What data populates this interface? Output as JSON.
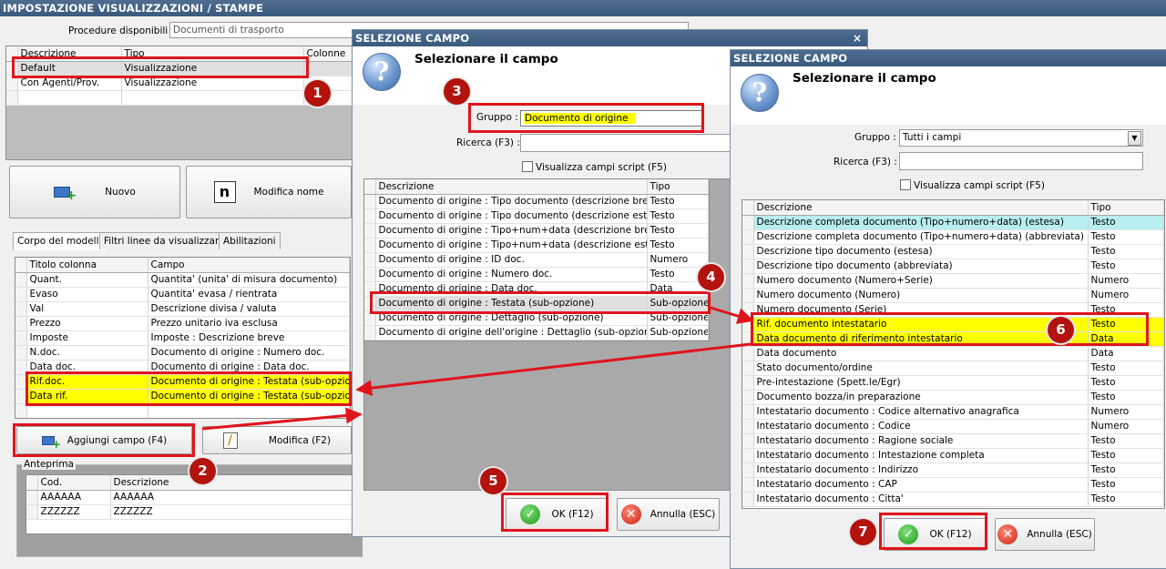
{
  "main": {
    "title": "IMPOSTAZIONE VISUALIZZAZIONI / STAMPE",
    "procedure_label": "Procedure disponibili :",
    "procedure_value": "Documenti di trasporto",
    "views_headers": [
      "Descrizione",
      "Tipo",
      "Colonne"
    ],
    "views_rows": [
      [
        "Default",
        "Visualizzazione",
        ""
      ],
      [
        "Con Agenti/Prov.",
        "Visualizzazione",
        ""
      ]
    ],
    "btn_nuovo": "Nuovo",
    "btn_modifica_nome": "Modifica nome",
    "tabs": [
      "Corpo del modello",
      "Filtri linee da visualizzare",
      "Abilitazioni"
    ],
    "columns_headers": [
      "Titolo colonna",
      "Campo"
    ],
    "columns_rows": [
      [
        "Quant.",
        "Quantita' (unita' di misura documento)"
      ],
      [
        "Evaso",
        "Quantita' evasa / rientrata"
      ],
      [
        "Val",
        "Descrizione divisa / valuta"
      ],
      [
        "Prezzo",
        "Prezzo unitario iva esclusa"
      ],
      [
        "Imposte",
        "Imposte : Descrizione breve"
      ],
      [
        "N.doc.",
        "Documento di origine : Numero doc."
      ],
      [
        "Data doc.",
        "Documento di origine : Data doc."
      ],
      [
        "Rif.doc.",
        "Documento di origine : Testata (sub-opzione)"
      ],
      [
        "Data rif.",
        "Documento di origine : Testata (sub-opzione)"
      ]
    ],
    "btn_aggiungi": "Aggiungi campo (F4)",
    "btn_modifica": "Modifica (F2)",
    "anteprima_label": "Anteprima",
    "preview_headers": [
      "Cod.",
      "Descrizione"
    ],
    "preview_rows": [
      [
        "AAAAAA",
        "AAAAAA"
      ],
      [
        "ZZZZZZ",
        "ZZZZZZ"
      ]
    ]
  },
  "dialog1": {
    "title": "SELEZIONE CAMPO",
    "close": "×",
    "heading": "Selezionare il campo",
    "gruppo_label": "Gruppo :",
    "gruppo_value": "Documento di origine",
    "ricerca_label": "Ricerca (F3) :",
    "ricerca_value": "",
    "checkbox_label": "Visualizza campi script (F5)",
    "headers": [
      "Descrizione",
      "Tipo"
    ],
    "rows": [
      [
        "Documento di origine : Tipo documento (descrizione breve)",
        "Testo"
      ],
      [
        "Documento di origine : Tipo documento (descrizione estesa)",
        "Testo"
      ],
      [
        "Documento di origine : Tipo+num+data (descrizione breve)",
        "Testo"
      ],
      [
        "Documento di origine : Tipo+num+data (descrizione estesa)",
        "Testo"
      ],
      [
        "Documento di origine : ID doc.",
        "Numero"
      ],
      [
        "Documento di origine : Numero doc.",
        "Testo"
      ],
      [
        "Documento di origine : Data doc.",
        "Data"
      ],
      [
        "Documento di origine : Testata (sub-opzione)",
        "Sub-opzione"
      ],
      [
        "Documento di origine : Dettaglio (sub-opzione)",
        "Sub-opzione"
      ],
      [
        "Documento di origine dell'origine : Dettaglio (sub-opzione)",
        "Sub-opzione"
      ]
    ],
    "ok": "OK (F12)",
    "cancel": "Annulla (ESC)"
  },
  "dialog2": {
    "title": "SELEZIONE CAMPO",
    "heading": "Selezionare il campo",
    "gruppo_label": "Gruppo :",
    "gruppo_value": "Tutti i campi",
    "ricerca_label": "Ricerca (F3) :",
    "ricerca_value": "",
    "checkbox_label": "Visualizza campi script (F5)",
    "headers": [
      "Descrizione",
      "Tipo"
    ],
    "rows": [
      [
        "Descrizione completa documento (Tipo+numero+data) (estesa)",
        "Testo"
      ],
      [
        "Descrizione completa documento (Tipo+numero+data) (abbreviata)",
        "Testo"
      ],
      [
        "Descrizione tipo documento (estesa)",
        "Testo"
      ],
      [
        "Descrizione tipo documento (abbreviata)",
        "Testo"
      ],
      [
        "Numero documento (Numero+Serie)",
        "Numero"
      ],
      [
        "Numero documento (Numero)",
        "Numero"
      ],
      [
        "Numero documento (Serie)",
        "Testo"
      ],
      [
        "Rif. documento intestatario",
        "Testo"
      ],
      [
        "Data documento di riferimento intestatario",
        "Data"
      ],
      [
        "Data documento",
        "Data"
      ],
      [
        "Stato documento/ordine",
        "Testo"
      ],
      [
        "Pre-intestazione (Spett.le/Egr)",
        "Testo"
      ],
      [
        "Documento bozza/in preparazione",
        "Testo"
      ],
      [
        "Intestatario documento : Codice alternativo anagrafica",
        "Numero"
      ],
      [
        "Intestatario documento : Codice",
        "Numero"
      ],
      [
        "Intestatario documento : Ragione sociale",
        "Testo"
      ],
      [
        "Intestatario documento : Intestazione completa",
        "Testo"
      ],
      [
        "Intestatario documento : Indirizzo",
        "Testo"
      ],
      [
        "Intestatario documento : CAP",
        "Testo"
      ],
      [
        "Intestatario documento : Citta'",
        "Testo"
      ]
    ],
    "ok": "OK (F12)",
    "cancel": "Annulla (ESC)"
  },
  "badges": [
    "1",
    "2",
    "3",
    "4",
    "5",
    "6",
    "7"
  ],
  "icons": {
    "help": "question-icon",
    "ok": "check-icon",
    "cancel": "x-icon",
    "add": "add-field-icon",
    "edit": "pencil-icon",
    "rename": "n-icon"
  },
  "colors": {
    "titlebar": "#3f5f84",
    "highlight": "#ffff00",
    "annotation": "#e0141c",
    "badge": "#b3120d",
    "cyan_row": "#b8eef0"
  }
}
